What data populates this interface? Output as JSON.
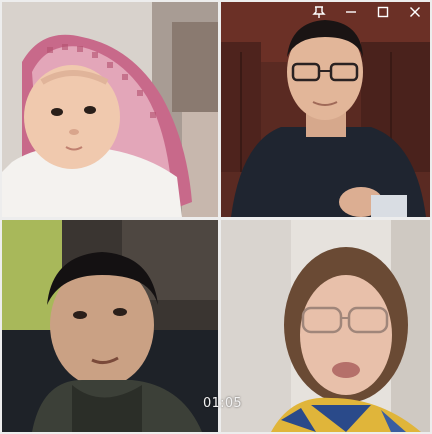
{
  "call": {
    "elapsed_time": "01:05"
  },
  "window_controls": {
    "icons": [
      "pin-icon",
      "minimize-icon",
      "maximize-icon",
      "close-icon"
    ]
  },
  "participants": [
    {
      "tile": "top-left",
      "video": "infant-wrapped-in-pink-checkered-hood"
    },
    {
      "tile": "top-right",
      "video": "man-with-glasses-in-dark-sweater"
    },
    {
      "tile": "bottom-left",
      "video": "young-man-close-up"
    },
    {
      "tile": "bottom-right",
      "video": "woman-with-glasses-and-yellow-blue-scarf"
    }
  ],
  "colors": {
    "background": "#ededed",
    "timer_text": "#f2f2f2",
    "control_icon": "#ffffff"
  }
}
